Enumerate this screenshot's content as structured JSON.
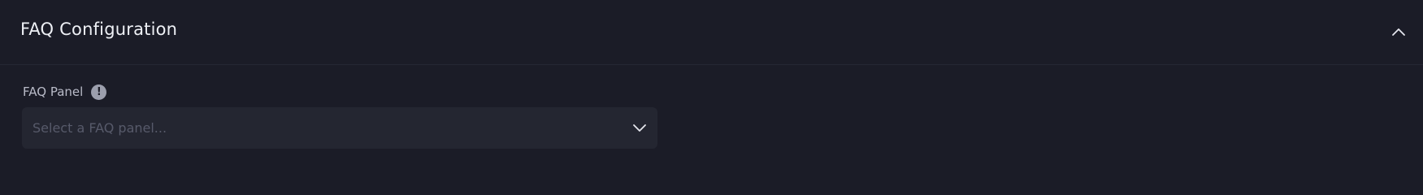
{
  "section": {
    "title": "FAQ Configuration",
    "collapse_icon": "chevron-up-icon"
  },
  "field": {
    "label": "FAQ Panel",
    "info_icon": "info-icon",
    "info_glyph": "!",
    "placeholder": "Select a FAQ panel...",
    "value": "",
    "dropdown_icon": "chevron-down-icon"
  },
  "colors": {
    "background": "#1b1c27",
    "input_background": "#242631",
    "title_text": "#eef0f5",
    "label_text": "#b9bbc8",
    "placeholder_text": "#575a6a"
  }
}
